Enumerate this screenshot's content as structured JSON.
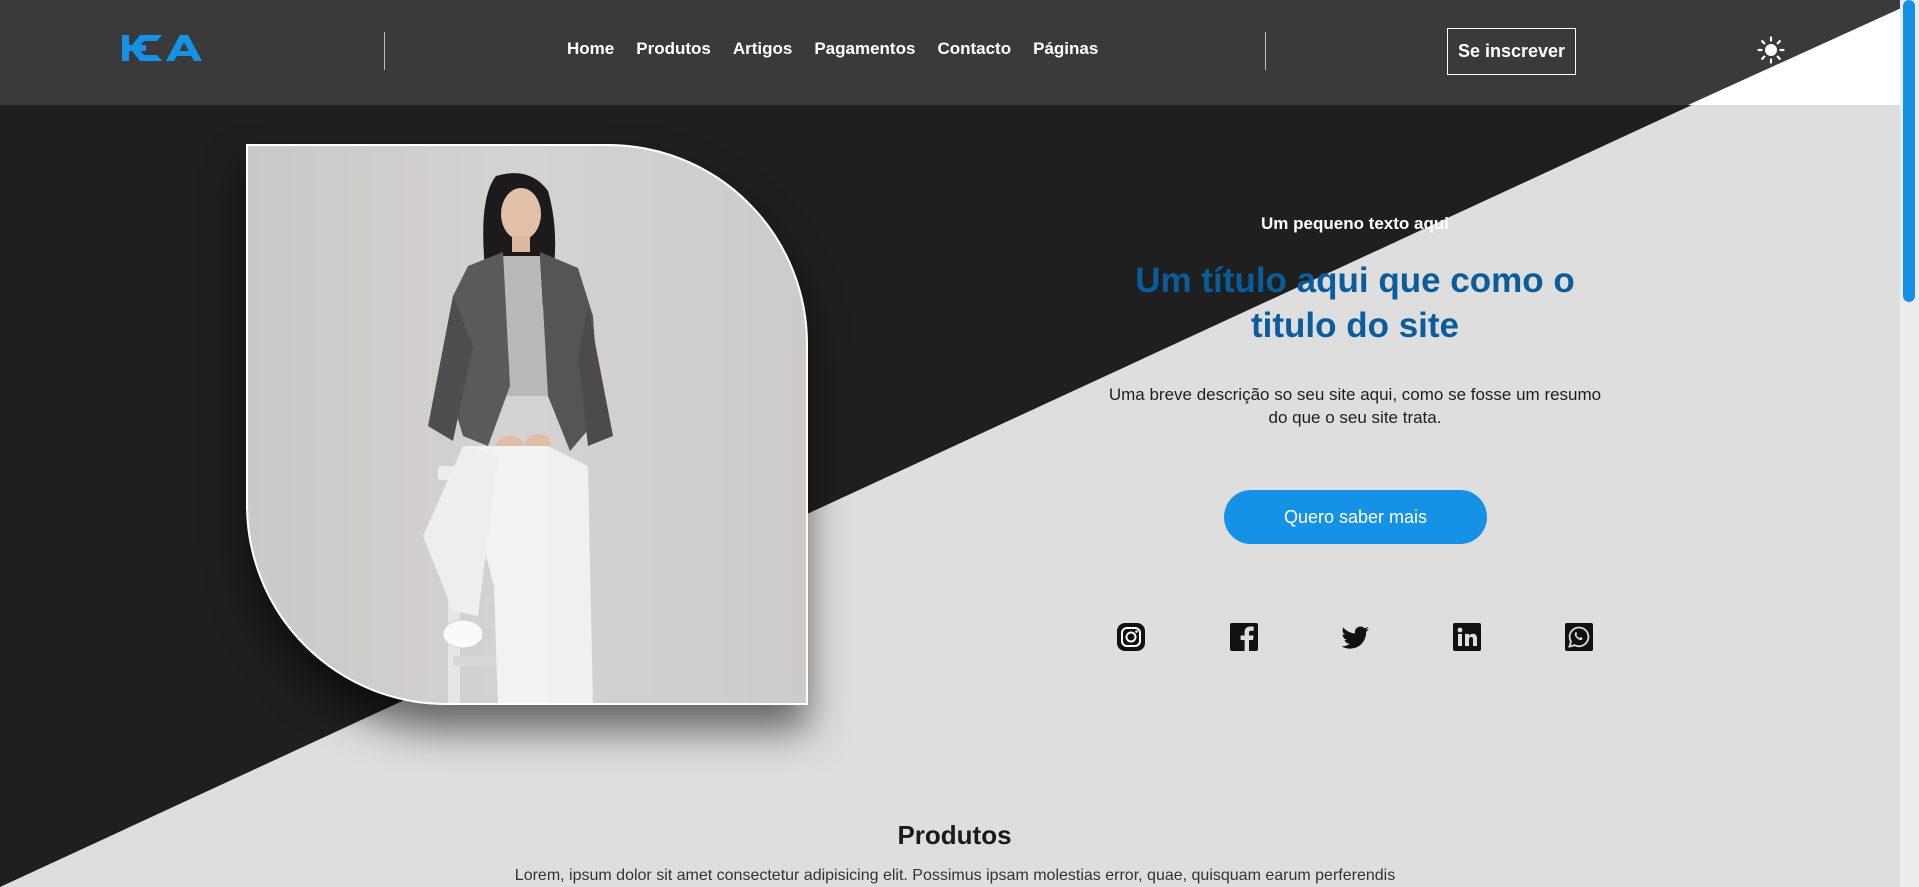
{
  "header": {
    "logo_text": "HCA",
    "nav": [
      "Home",
      "Produtos",
      "Artigos",
      "Pagamentos",
      "Contacto",
      "Páginas"
    ],
    "signup_label": "Se inscrever"
  },
  "hero": {
    "small_text": "Um pequeno texto aqui",
    "title_line1": "Um título aqui que como o",
    "title_line2": "titulo do site",
    "description_line1": "Uma breve descrição so seu site aqui, como se fosse um resumo",
    "description_line2": "do que o seu site trata.",
    "cta_label": "Quero saber mais"
  },
  "social_icons": [
    "instagram-icon",
    "facebook-icon",
    "twitter-icon",
    "linkedin-icon",
    "whatsapp-icon"
  ],
  "products": {
    "title": "Produtos",
    "description": "Lorem, ipsum dolor sit amet consectetur adipisicing elit. Possimus ipsam molestias error, quae, quisquam earum perferendis"
  },
  "colors": {
    "accent": "#1592e6",
    "title_blue": "#0b5c9a",
    "dark_bg": "#1f1f1f",
    "header_bg": "#3a3a3a",
    "light_bg": "#dedede"
  }
}
